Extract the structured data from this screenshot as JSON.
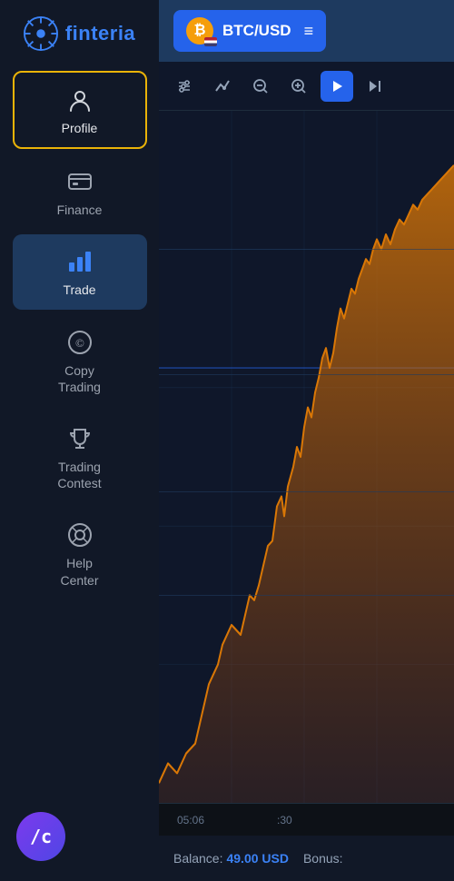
{
  "app": {
    "name": "finteria"
  },
  "sidebar": {
    "items": [
      {
        "id": "profile",
        "label": "Profile",
        "icon": "👤",
        "state": "active-profile"
      },
      {
        "id": "finance",
        "label": "Finance",
        "icon": "💳",
        "state": ""
      },
      {
        "id": "trade",
        "label": "Trade",
        "icon": "📈",
        "state": "active-trade"
      },
      {
        "id": "copy-trading",
        "label": "Copy\nTrading",
        "icon": "©",
        "state": ""
      },
      {
        "id": "trading-contest",
        "label": "Trading\nContest",
        "icon": "🏆",
        "state": ""
      },
      {
        "id": "help-center",
        "label": "Help\nCenter",
        "icon": "🎧",
        "state": ""
      }
    ]
  },
  "header": {
    "pair": "BTC/USD",
    "pair_icon": "₿"
  },
  "toolbar": {
    "tools": [
      {
        "id": "indicators",
        "icon": "⧉",
        "label": "indicators",
        "active": false
      },
      {
        "id": "draw",
        "icon": "✓",
        "label": "draw",
        "active": false
      },
      {
        "id": "zoom-out",
        "icon": "⊖",
        "label": "zoom-out",
        "active": false
      },
      {
        "id": "zoom-in",
        "icon": "⊕",
        "label": "zoom-in",
        "active": false
      },
      {
        "id": "play",
        "icon": "▶",
        "label": "play",
        "active": true
      },
      {
        "id": "last",
        "icon": "⊣",
        "label": "last",
        "active": false
      }
    ]
  },
  "chart": {
    "time_labels": [
      "05:06",
      ":30"
    ],
    "price_line_y": 38
  },
  "footer": {
    "balance_label": "Balance:",
    "balance_value": "49.00 USD",
    "bonus_label": "Bonus:"
  }
}
